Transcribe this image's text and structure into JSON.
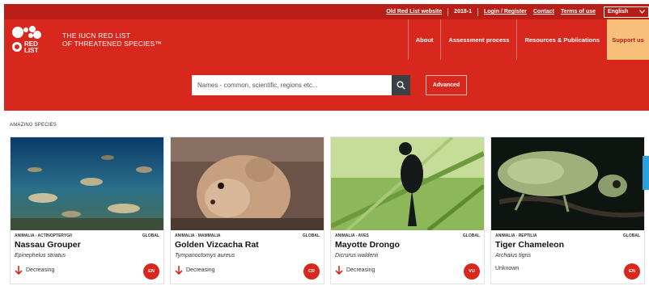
{
  "topbar": {
    "old_site": "Old Red List website",
    "version": "2018-1",
    "login": "Login / Register",
    "contact": "Contact",
    "terms": "Terms of use",
    "language": "English"
  },
  "header": {
    "logo_text": "RED LIST",
    "brand_line1": "THE IUCN RED LIST",
    "brand_line2": "OF THREATENED SPECIES™",
    "nav": [
      "About",
      "Assessment process",
      "Resources & Publications",
      "Support us"
    ]
  },
  "search": {
    "placeholder": "Names - common, scientific, regions etc...",
    "advanced_label": "Advanced"
  },
  "section_title": "AMAZING SPECIES",
  "cards": [
    {
      "taxonomy": "ANIMALIA - ACTINOPTERYGII",
      "scope": "GLOBAL",
      "name": "Nassau Grouper",
      "scientific": "Epinephelus striatus",
      "trend": "Decreasing",
      "category": "EN"
    },
    {
      "taxonomy": "ANIMALIA - MAMMALIA",
      "scope": "GLOBAL",
      "name": "Golden Vizcacha Rat",
      "scientific": "Tympanoctomys aureus",
      "trend": "Decreasing",
      "category": "CR"
    },
    {
      "taxonomy": "ANIMALIA - AVES",
      "scope": "GLOBAL",
      "name": "Mayotte Drongo",
      "scientific": "Dicrurus waldenii",
      "trend": "Decreasing",
      "category": "VU"
    },
    {
      "taxonomy": "ANIMALIA - REPTILIA",
      "scope": "GLOBAL",
      "name": "Tiger Chameleon",
      "scientific": "Archaius tigris",
      "trend": "Unknown",
      "category": "EN"
    }
  ],
  "colors": {
    "brand_red": "#d8271c",
    "dark_red": "#b81e15",
    "support_bg": "#f7bf7a",
    "search_button": "#3c3f44"
  }
}
